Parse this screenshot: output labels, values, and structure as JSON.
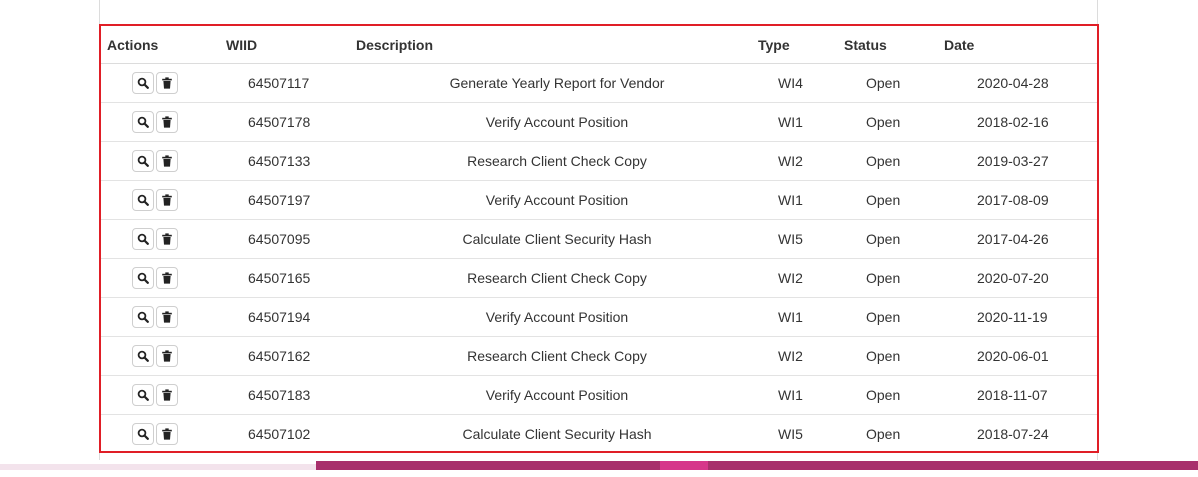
{
  "table": {
    "headers": {
      "actions": "Actions",
      "wiid": "WIID",
      "description": "Description",
      "type": "Type",
      "status": "Status",
      "date": "Date"
    },
    "row_action_icons": [
      "search-icon",
      "trash-icon"
    ],
    "rows": [
      {
        "wiid": "64507117",
        "description": "Generate Yearly Report for Vendor",
        "type": "WI4",
        "status": "Open",
        "date": "2020-04-28"
      },
      {
        "wiid": "64507178",
        "description": "Verify Account Position",
        "type": "WI1",
        "status": "Open",
        "date": "2018-02-16"
      },
      {
        "wiid": "64507133",
        "description": "Research Client Check Copy",
        "type": "WI2",
        "status": "Open",
        "date": "2019-03-27"
      },
      {
        "wiid": "64507197",
        "description": "Verify Account Position",
        "type": "WI1",
        "status": "Open",
        "date": "2017-08-09"
      },
      {
        "wiid": "64507095",
        "description": "Calculate Client Security Hash",
        "type": "WI5",
        "status": "Open",
        "date": "2017-04-26"
      },
      {
        "wiid": "64507165",
        "description": "Research Client Check Copy",
        "type": "WI2",
        "status": "Open",
        "date": "2020-07-20"
      },
      {
        "wiid": "64507194",
        "description": "Verify Account Position",
        "type": "WI1",
        "status": "Open",
        "date": "2020-11-19"
      },
      {
        "wiid": "64507162",
        "description": "Research Client Check Copy",
        "type": "WI2",
        "status": "Open",
        "date": "2020-06-01"
      },
      {
        "wiid": "64507183",
        "description": "Verify Account Position",
        "type": "WI1",
        "status": "Open",
        "date": "2018-11-07"
      },
      {
        "wiid": "64507102",
        "description": "Calculate Client Security Hash",
        "type": "WI5",
        "status": "Open",
        "date": "2018-07-24"
      }
    ]
  },
  "colors": {
    "highlight_border": "#e01e26",
    "footer_bar": "#a8306c",
    "footer_accent": "#d6378a"
  }
}
